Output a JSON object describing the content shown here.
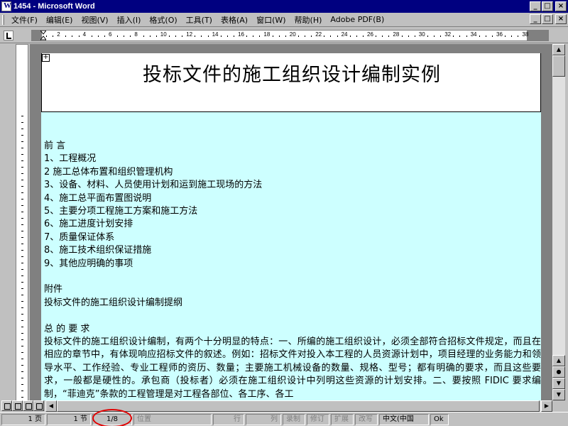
{
  "window": {
    "title": "1454 - Microsoft Word",
    "min": "_",
    "max": "□",
    "close": "×"
  },
  "menu": {
    "items": [
      "文件(F)",
      "编辑(E)",
      "视图(V)",
      "插入(I)",
      "格式(O)",
      "工具(T)",
      "表格(A)",
      "窗口(W)",
      "帮助(H)",
      "Adobe PDF(B)"
    ]
  },
  "document": {
    "title": "投标文件的施工组织设计编制实例",
    "toc_heading": "前 言",
    "toc": [
      "1、工程概况",
      "2 施工总体布置和组织管理机构",
      "3、设备、材料、人员使用计划和运到施工现场的方法",
      "4、施工总平面布置图说明",
      "5、主要分项工程施工方案和施工方法",
      "6、施工进度计划安排",
      "7、质量保证体系",
      "8、施工技术组织保证措施",
      "9、其他应明确的事项"
    ],
    "appendix": "附件",
    "appendix_title": "投标文件的施工组织设计编制提纲",
    "section_heading": "总 的 要 求",
    "paragraph": "投标文件的施工组织设计编制，有两个十分明显的特点：一、所编的施工组织设计，必须全部符合招标文件规定，而且在相应的章节中，有体现响应招标文件的叙述。例如：招标文件对投入本工程的人员资源计划中，项目经理的业务能力和领导水平、工作经验、专业工程师的资历、数量；主要施工机械设备的数量、规格、型号；都有明确的要求，而且这些要求，一般都是硬性的。承包商（投标者）必须在施工组织设计中列明这些资源的计划安排。二、要按照 FIDIC 要求编制，“菲迪克”条款的工程管理是对工程各部位、各工序、各工"
  },
  "ruler": {
    "numbers": [
      "2",
      "4",
      "6",
      "8",
      "10",
      "12",
      "14",
      "16",
      "18",
      "20",
      "22",
      "24",
      "26",
      "28",
      "30",
      "32",
      "34",
      "36",
      "38"
    ]
  },
  "status": {
    "page": "1 页",
    "section": "1 节",
    "pages": "1/8",
    "position": "位置",
    "line": "行",
    "column": "列",
    "rec": "录制",
    "trk": "修订",
    "ext": "扩展",
    "ovr": "改写",
    "lang": "中文(中国",
    "icon_label": "Ok"
  }
}
